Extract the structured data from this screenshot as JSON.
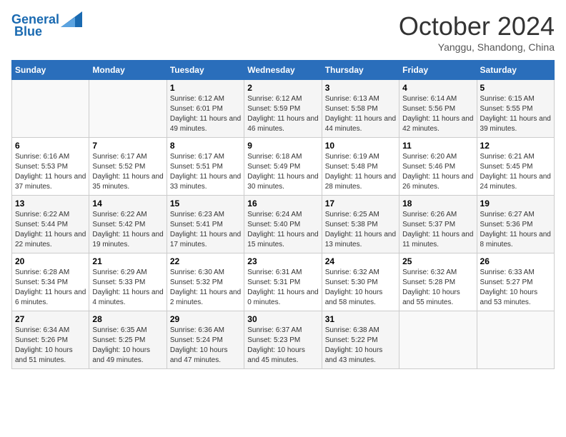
{
  "logo": {
    "line1": "General",
    "line2": "Blue"
  },
  "title": "October 2024",
  "subtitle": "Yanggu, Shandong, China",
  "headers": [
    "Sunday",
    "Monday",
    "Tuesday",
    "Wednesday",
    "Thursday",
    "Friday",
    "Saturday"
  ],
  "weeks": [
    [
      {
        "day": "",
        "info": ""
      },
      {
        "day": "",
        "info": ""
      },
      {
        "day": "1",
        "info": "Sunrise: 6:12 AM\nSunset: 6:01 PM\nDaylight: 11 hours and 49 minutes."
      },
      {
        "day": "2",
        "info": "Sunrise: 6:12 AM\nSunset: 5:59 PM\nDaylight: 11 hours and 46 minutes."
      },
      {
        "day": "3",
        "info": "Sunrise: 6:13 AM\nSunset: 5:58 PM\nDaylight: 11 hours and 44 minutes."
      },
      {
        "day": "4",
        "info": "Sunrise: 6:14 AM\nSunset: 5:56 PM\nDaylight: 11 hours and 42 minutes."
      },
      {
        "day": "5",
        "info": "Sunrise: 6:15 AM\nSunset: 5:55 PM\nDaylight: 11 hours and 39 minutes."
      }
    ],
    [
      {
        "day": "6",
        "info": "Sunrise: 6:16 AM\nSunset: 5:53 PM\nDaylight: 11 hours and 37 minutes."
      },
      {
        "day": "7",
        "info": "Sunrise: 6:17 AM\nSunset: 5:52 PM\nDaylight: 11 hours and 35 minutes."
      },
      {
        "day": "8",
        "info": "Sunrise: 6:17 AM\nSunset: 5:51 PM\nDaylight: 11 hours and 33 minutes."
      },
      {
        "day": "9",
        "info": "Sunrise: 6:18 AM\nSunset: 5:49 PM\nDaylight: 11 hours and 30 minutes."
      },
      {
        "day": "10",
        "info": "Sunrise: 6:19 AM\nSunset: 5:48 PM\nDaylight: 11 hours and 28 minutes."
      },
      {
        "day": "11",
        "info": "Sunrise: 6:20 AM\nSunset: 5:46 PM\nDaylight: 11 hours and 26 minutes."
      },
      {
        "day": "12",
        "info": "Sunrise: 6:21 AM\nSunset: 5:45 PM\nDaylight: 11 hours and 24 minutes."
      }
    ],
    [
      {
        "day": "13",
        "info": "Sunrise: 6:22 AM\nSunset: 5:44 PM\nDaylight: 11 hours and 22 minutes."
      },
      {
        "day": "14",
        "info": "Sunrise: 6:22 AM\nSunset: 5:42 PM\nDaylight: 11 hours and 19 minutes."
      },
      {
        "day": "15",
        "info": "Sunrise: 6:23 AM\nSunset: 5:41 PM\nDaylight: 11 hours and 17 minutes."
      },
      {
        "day": "16",
        "info": "Sunrise: 6:24 AM\nSunset: 5:40 PM\nDaylight: 11 hours and 15 minutes."
      },
      {
        "day": "17",
        "info": "Sunrise: 6:25 AM\nSunset: 5:38 PM\nDaylight: 11 hours and 13 minutes."
      },
      {
        "day": "18",
        "info": "Sunrise: 6:26 AM\nSunset: 5:37 PM\nDaylight: 11 hours and 11 minutes."
      },
      {
        "day": "19",
        "info": "Sunrise: 6:27 AM\nSunset: 5:36 PM\nDaylight: 11 hours and 8 minutes."
      }
    ],
    [
      {
        "day": "20",
        "info": "Sunrise: 6:28 AM\nSunset: 5:34 PM\nDaylight: 11 hours and 6 minutes."
      },
      {
        "day": "21",
        "info": "Sunrise: 6:29 AM\nSunset: 5:33 PM\nDaylight: 11 hours and 4 minutes."
      },
      {
        "day": "22",
        "info": "Sunrise: 6:30 AM\nSunset: 5:32 PM\nDaylight: 11 hours and 2 minutes."
      },
      {
        "day": "23",
        "info": "Sunrise: 6:31 AM\nSunset: 5:31 PM\nDaylight: 11 hours and 0 minutes."
      },
      {
        "day": "24",
        "info": "Sunrise: 6:32 AM\nSunset: 5:30 PM\nDaylight: 10 hours and 58 minutes."
      },
      {
        "day": "25",
        "info": "Sunrise: 6:32 AM\nSunset: 5:28 PM\nDaylight: 10 hours and 55 minutes."
      },
      {
        "day": "26",
        "info": "Sunrise: 6:33 AM\nSunset: 5:27 PM\nDaylight: 10 hours and 53 minutes."
      }
    ],
    [
      {
        "day": "27",
        "info": "Sunrise: 6:34 AM\nSunset: 5:26 PM\nDaylight: 10 hours and 51 minutes."
      },
      {
        "day": "28",
        "info": "Sunrise: 6:35 AM\nSunset: 5:25 PM\nDaylight: 10 hours and 49 minutes."
      },
      {
        "day": "29",
        "info": "Sunrise: 6:36 AM\nSunset: 5:24 PM\nDaylight: 10 hours and 47 minutes."
      },
      {
        "day": "30",
        "info": "Sunrise: 6:37 AM\nSunset: 5:23 PM\nDaylight: 10 hours and 45 minutes."
      },
      {
        "day": "31",
        "info": "Sunrise: 6:38 AM\nSunset: 5:22 PM\nDaylight: 10 hours and 43 minutes."
      },
      {
        "day": "",
        "info": ""
      },
      {
        "day": "",
        "info": ""
      }
    ]
  ]
}
